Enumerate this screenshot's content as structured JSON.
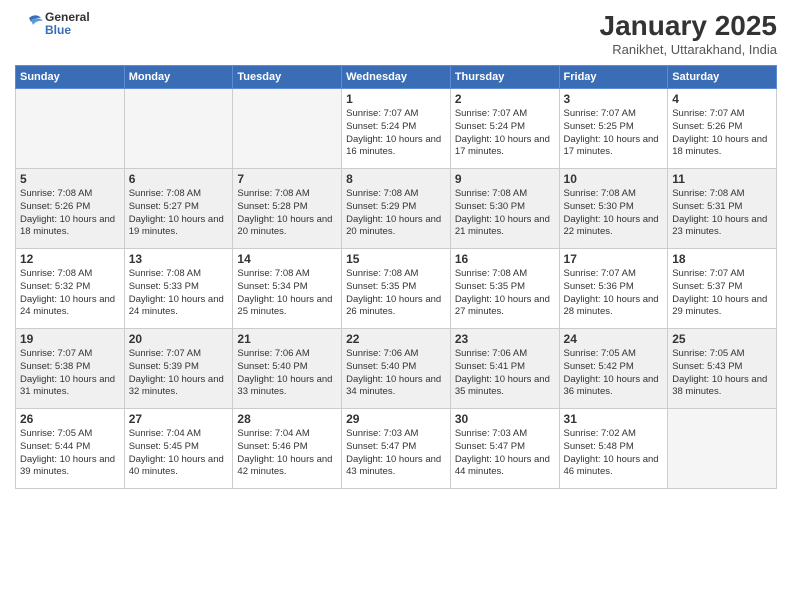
{
  "header": {
    "logo_line1": "General",
    "logo_line2": "Blue",
    "month": "January 2025",
    "location": "Ranikhet, Uttarakhand, India"
  },
  "weekdays": [
    "Sunday",
    "Monday",
    "Tuesday",
    "Wednesday",
    "Thursday",
    "Friday",
    "Saturday"
  ],
  "weeks": [
    [
      {
        "day": "",
        "info": ""
      },
      {
        "day": "",
        "info": ""
      },
      {
        "day": "",
        "info": ""
      },
      {
        "day": "1",
        "info": "Sunrise: 7:07 AM\nSunset: 5:24 PM\nDaylight: 10 hours\nand 16 minutes."
      },
      {
        "day": "2",
        "info": "Sunrise: 7:07 AM\nSunset: 5:24 PM\nDaylight: 10 hours\nand 17 minutes."
      },
      {
        "day": "3",
        "info": "Sunrise: 7:07 AM\nSunset: 5:25 PM\nDaylight: 10 hours\nand 17 minutes."
      },
      {
        "day": "4",
        "info": "Sunrise: 7:07 AM\nSunset: 5:26 PM\nDaylight: 10 hours\nand 18 minutes."
      }
    ],
    [
      {
        "day": "5",
        "info": "Sunrise: 7:08 AM\nSunset: 5:26 PM\nDaylight: 10 hours\nand 18 minutes."
      },
      {
        "day": "6",
        "info": "Sunrise: 7:08 AM\nSunset: 5:27 PM\nDaylight: 10 hours\nand 19 minutes."
      },
      {
        "day": "7",
        "info": "Sunrise: 7:08 AM\nSunset: 5:28 PM\nDaylight: 10 hours\nand 20 minutes."
      },
      {
        "day": "8",
        "info": "Sunrise: 7:08 AM\nSunset: 5:29 PM\nDaylight: 10 hours\nand 20 minutes."
      },
      {
        "day": "9",
        "info": "Sunrise: 7:08 AM\nSunset: 5:30 PM\nDaylight: 10 hours\nand 21 minutes."
      },
      {
        "day": "10",
        "info": "Sunrise: 7:08 AM\nSunset: 5:30 PM\nDaylight: 10 hours\nand 22 minutes."
      },
      {
        "day": "11",
        "info": "Sunrise: 7:08 AM\nSunset: 5:31 PM\nDaylight: 10 hours\nand 23 minutes."
      }
    ],
    [
      {
        "day": "12",
        "info": "Sunrise: 7:08 AM\nSunset: 5:32 PM\nDaylight: 10 hours\nand 24 minutes."
      },
      {
        "day": "13",
        "info": "Sunrise: 7:08 AM\nSunset: 5:33 PM\nDaylight: 10 hours\nand 24 minutes."
      },
      {
        "day": "14",
        "info": "Sunrise: 7:08 AM\nSunset: 5:34 PM\nDaylight: 10 hours\nand 25 minutes."
      },
      {
        "day": "15",
        "info": "Sunrise: 7:08 AM\nSunset: 5:35 PM\nDaylight: 10 hours\nand 26 minutes."
      },
      {
        "day": "16",
        "info": "Sunrise: 7:08 AM\nSunset: 5:35 PM\nDaylight: 10 hours\nand 27 minutes."
      },
      {
        "day": "17",
        "info": "Sunrise: 7:07 AM\nSunset: 5:36 PM\nDaylight: 10 hours\nand 28 minutes."
      },
      {
        "day": "18",
        "info": "Sunrise: 7:07 AM\nSunset: 5:37 PM\nDaylight: 10 hours\nand 29 minutes."
      }
    ],
    [
      {
        "day": "19",
        "info": "Sunrise: 7:07 AM\nSunset: 5:38 PM\nDaylight: 10 hours\nand 31 minutes."
      },
      {
        "day": "20",
        "info": "Sunrise: 7:07 AM\nSunset: 5:39 PM\nDaylight: 10 hours\nand 32 minutes."
      },
      {
        "day": "21",
        "info": "Sunrise: 7:06 AM\nSunset: 5:40 PM\nDaylight: 10 hours\nand 33 minutes."
      },
      {
        "day": "22",
        "info": "Sunrise: 7:06 AM\nSunset: 5:40 PM\nDaylight: 10 hours\nand 34 minutes."
      },
      {
        "day": "23",
        "info": "Sunrise: 7:06 AM\nSunset: 5:41 PM\nDaylight: 10 hours\nand 35 minutes."
      },
      {
        "day": "24",
        "info": "Sunrise: 7:05 AM\nSunset: 5:42 PM\nDaylight: 10 hours\nand 36 minutes."
      },
      {
        "day": "25",
        "info": "Sunrise: 7:05 AM\nSunset: 5:43 PM\nDaylight: 10 hours\nand 38 minutes."
      }
    ],
    [
      {
        "day": "26",
        "info": "Sunrise: 7:05 AM\nSunset: 5:44 PM\nDaylight: 10 hours\nand 39 minutes."
      },
      {
        "day": "27",
        "info": "Sunrise: 7:04 AM\nSunset: 5:45 PM\nDaylight: 10 hours\nand 40 minutes."
      },
      {
        "day": "28",
        "info": "Sunrise: 7:04 AM\nSunset: 5:46 PM\nDaylight: 10 hours\nand 42 minutes."
      },
      {
        "day": "29",
        "info": "Sunrise: 7:03 AM\nSunset: 5:47 PM\nDaylight: 10 hours\nand 43 minutes."
      },
      {
        "day": "30",
        "info": "Sunrise: 7:03 AM\nSunset: 5:47 PM\nDaylight: 10 hours\nand 44 minutes."
      },
      {
        "day": "31",
        "info": "Sunrise: 7:02 AM\nSunset: 5:48 PM\nDaylight: 10 hours\nand 46 minutes."
      },
      {
        "day": "",
        "info": ""
      }
    ]
  ]
}
